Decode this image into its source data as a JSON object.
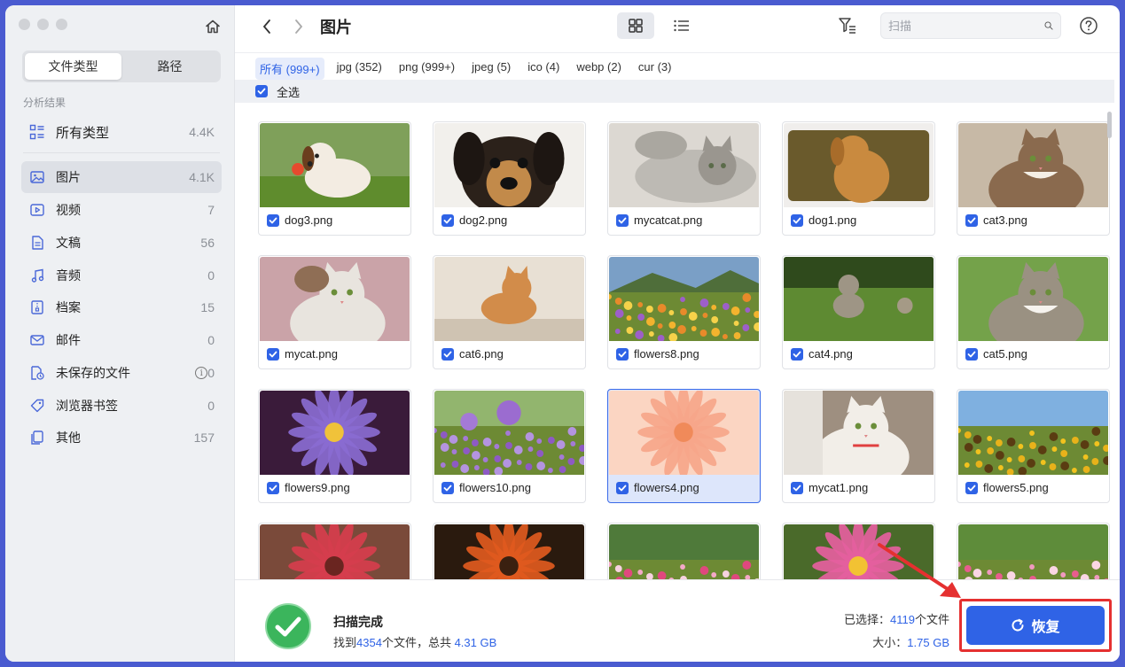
{
  "sidebar": {
    "tabs": [
      {
        "label": "文件类型"
      },
      {
        "label": "路径"
      }
    ],
    "section": "分析结果",
    "summary": {
      "label": "所有类型",
      "count": "4.4K"
    },
    "items": [
      {
        "label": "图片",
        "count": "4.1K",
        "icon": "image-icon"
      },
      {
        "label": "视频",
        "count": "7",
        "icon": "video-icon"
      },
      {
        "label": "文稿",
        "count": "56",
        "icon": "document-icon"
      },
      {
        "label": "音频",
        "count": "0",
        "icon": "music-icon"
      },
      {
        "label": "档案",
        "count": "15",
        "icon": "archive-icon"
      },
      {
        "label": "邮件",
        "count": "0",
        "icon": "mail-icon"
      },
      {
        "label": "未保存的文件",
        "count": "0",
        "icon": "unsaved-file-icon"
      },
      {
        "label": "浏览器书签",
        "count": "0",
        "icon": "bookmark-icon"
      },
      {
        "label": "其他",
        "count": "157",
        "icon": "other-icon"
      }
    ]
  },
  "toolbar": {
    "title": "图片",
    "search_placeholder": "扫描"
  },
  "ext_tabs": [
    {
      "label": "所有 (999+)"
    },
    {
      "label": "jpg (352)"
    },
    {
      "label": "png (999+)"
    },
    {
      "label": "jpeg (5)"
    },
    {
      "label": "ico (4)"
    },
    {
      "label": "webp (2)"
    },
    {
      "label": "cur (3)"
    }
  ],
  "select_all": "全选",
  "files": [
    {
      "name": "dog3.png"
    },
    {
      "name": "dog2.png"
    },
    {
      "name": "mycatcat.png"
    },
    {
      "name": "dog1.png"
    },
    {
      "name": "cat3.png"
    },
    {
      "name": "mycat.png"
    },
    {
      "name": "cat6.png"
    },
    {
      "name": "flowers8.png"
    },
    {
      "name": "cat4.png"
    },
    {
      "name": "cat5.png"
    },
    {
      "name": "flowers9.png"
    },
    {
      "name": "flowers10.png"
    },
    {
      "name": "flowers4.png"
    },
    {
      "name": "mycat1.png"
    },
    {
      "name": "flowers5.png"
    }
  ],
  "footer": {
    "title": "扫描完成",
    "found_prefix": "找到",
    "found_count": "4354",
    "found_mid": "个文件，总共",
    "found_size": "4.31 GB",
    "selected_label": "已选择：",
    "selected_count": "4119",
    "selected_suffix": "个文件",
    "size_label": "大小：",
    "size_value": "1.75 GB",
    "recover_label": "恢复"
  },
  "colors": {
    "accent": "#2f63e6",
    "highlight": "#e53030",
    "success": "#3bb55c"
  }
}
